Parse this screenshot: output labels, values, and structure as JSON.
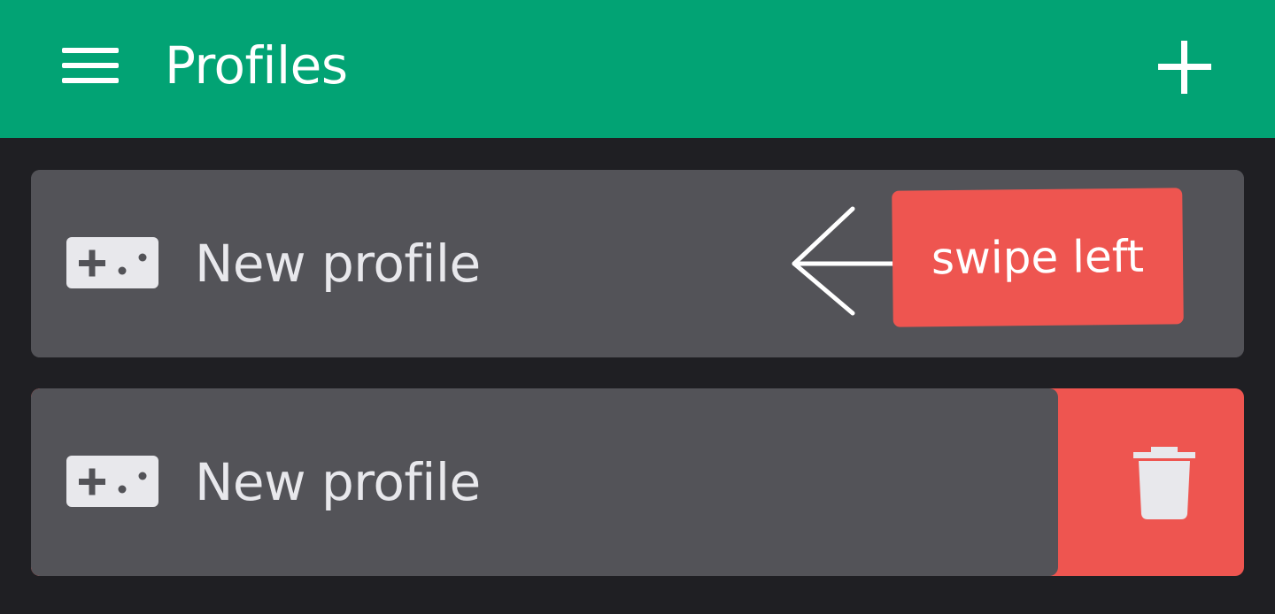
{
  "appbar": {
    "title": "Profiles",
    "menu_icon": "hamburger-menu-icon",
    "add_icon": "plus-icon",
    "color": "#02a374"
  },
  "profiles": [
    {
      "label": "New profile",
      "icon": "gamepad-icon"
    },
    {
      "label": "New profile",
      "icon": "gamepad-icon",
      "swipe_action": "delete",
      "action_icon": "trash-icon"
    }
  ],
  "hint": {
    "text": "swipe left",
    "icon": "arrow-left-icon",
    "color": "#ee5550"
  },
  "colors": {
    "background": "#1f1f23",
    "card": "#535358",
    "delete": "#ee5550"
  }
}
